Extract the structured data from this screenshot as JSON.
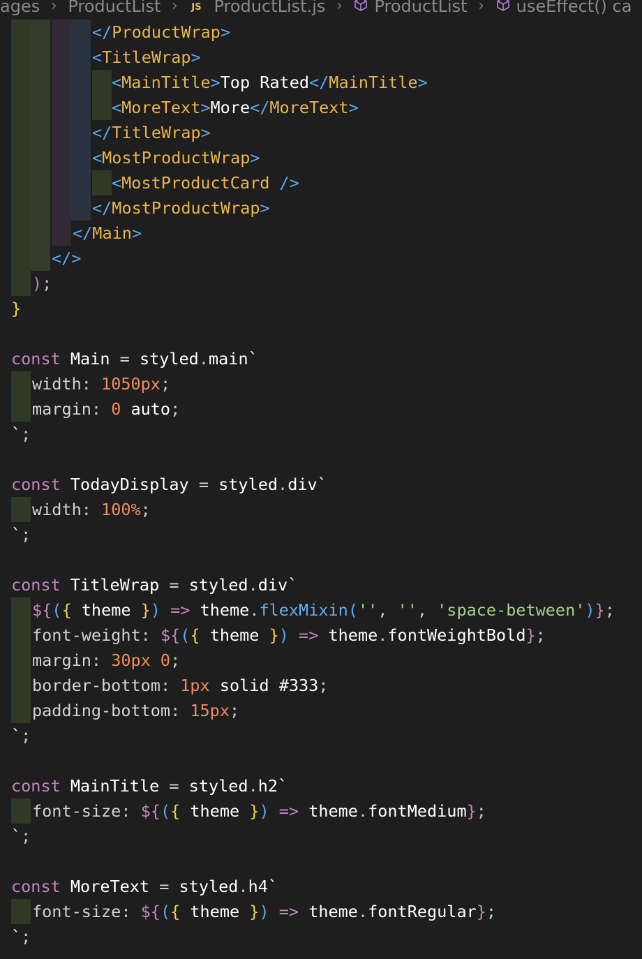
{
  "breadcrumb": {
    "items": [
      "ages",
      "ProductList",
      "ProductList.js",
      "ProductList",
      "useEffect() ca"
    ],
    "js_badge": "JS"
  },
  "colors": {
    "background": "#1e1e1e",
    "jsx_component": "#e9b44c",
    "jsx_bracket": "#5aa9f0",
    "keyword": "#c586c0",
    "number": "#f28b60",
    "string": "#a6d189",
    "method": "#61afef"
  },
  "code": {
    "lines": [
      {
        "tokens": [
          [
            "t-brace-b",
            "</"
          ],
          [
            "t-comp",
            "ProductWrap"
          ],
          [
            "t-brace-b",
            ">"
          ]
        ]
      },
      {
        "tokens": [
          [
            "t-brace-b",
            "<"
          ],
          [
            "t-comp",
            "TitleWrap"
          ],
          [
            "t-brace-b",
            ">"
          ]
        ]
      },
      {
        "tokens": [
          [
            "t-brace-b",
            "<"
          ],
          [
            "t-comp",
            "MainTitle"
          ],
          [
            "t-brace-b",
            ">"
          ],
          [
            "t-text",
            "Top Rated"
          ],
          [
            "t-brace-b",
            "</"
          ],
          [
            "t-comp",
            "MainTitle"
          ],
          [
            "t-brace-b",
            ">"
          ]
        ]
      },
      {
        "tokens": [
          [
            "t-brace-b",
            "<"
          ],
          [
            "t-comp",
            "MoreText"
          ],
          [
            "t-brace-b",
            ">"
          ],
          [
            "t-text",
            "More"
          ],
          [
            "t-brace-b",
            "</"
          ],
          [
            "t-comp",
            "MoreText"
          ],
          [
            "t-brace-b",
            ">"
          ]
        ]
      },
      {
        "tokens": [
          [
            "t-brace-b",
            "</"
          ],
          [
            "t-comp",
            "TitleWrap"
          ],
          [
            "t-brace-b",
            ">"
          ]
        ]
      },
      {
        "tokens": [
          [
            "t-brace-b",
            "<"
          ],
          [
            "t-comp",
            "MostProductWrap"
          ],
          [
            "t-brace-b",
            ">"
          ]
        ]
      },
      {
        "tokens": [
          [
            "t-brace-b",
            "<"
          ],
          [
            "t-comp",
            "MostProductCard"
          ],
          [
            "t-text",
            " "
          ],
          [
            "t-brace-b",
            "/>"
          ]
        ]
      },
      {
        "tokens": [
          [
            "t-brace-b",
            "</"
          ],
          [
            "t-comp",
            "MostProductWrap"
          ],
          [
            "t-brace-b",
            ">"
          ]
        ]
      },
      {
        "tokens": [
          [
            "t-brace-b",
            "</"
          ],
          [
            "t-comp",
            "Main"
          ],
          [
            "t-brace-b",
            ">"
          ]
        ]
      },
      {
        "tokens": [
          [
            "t-brace-b",
            "</>"
          ]
        ]
      },
      {
        "tokens": [
          [
            "t-brace-p",
            ")"
          ],
          [
            "t-punct",
            ";"
          ]
        ]
      },
      {
        "tokens": [
          [
            "t-brace-y",
            "}"
          ]
        ]
      },
      {
        "tokens": []
      },
      {
        "tokens": [
          [
            "t-kw",
            "const"
          ],
          [
            "t-id",
            " Main "
          ],
          [
            "t-op",
            "="
          ],
          [
            "t-id",
            " styled"
          ],
          [
            "t-punct",
            "."
          ],
          [
            "t-fn",
            "main"
          ],
          [
            "t-tpl",
            "`"
          ]
        ]
      },
      {
        "tokens": [
          [
            "t-prop",
            "width"
          ],
          [
            "t-punct",
            ": "
          ],
          [
            "t-num",
            "1050px"
          ],
          [
            "t-punct",
            ";"
          ]
        ]
      },
      {
        "tokens": [
          [
            "t-prop",
            "margin"
          ],
          [
            "t-punct",
            ": "
          ],
          [
            "t-num",
            "0"
          ],
          [
            "t-id",
            " auto"
          ],
          [
            "t-punct",
            ";"
          ]
        ]
      },
      {
        "tokens": [
          [
            "t-tpl",
            "`"
          ],
          [
            "t-punct",
            ";"
          ]
        ]
      },
      {
        "tokens": []
      },
      {
        "tokens": [
          [
            "t-kw",
            "const"
          ],
          [
            "t-id",
            " TodayDisplay "
          ],
          [
            "t-op",
            "="
          ],
          [
            "t-id",
            " styled"
          ],
          [
            "t-punct",
            "."
          ],
          [
            "t-fn",
            "div"
          ],
          [
            "t-tpl",
            "`"
          ]
        ]
      },
      {
        "tokens": [
          [
            "t-prop",
            "width"
          ],
          [
            "t-punct",
            ": "
          ],
          [
            "t-num",
            "100%"
          ],
          [
            "t-punct",
            ";"
          ]
        ]
      },
      {
        "tokens": [
          [
            "t-tpl",
            "`"
          ],
          [
            "t-punct",
            ";"
          ]
        ]
      },
      {
        "tokens": []
      },
      {
        "tokens": [
          [
            "t-kw",
            "const"
          ],
          [
            "t-id",
            " TitleWrap "
          ],
          [
            "t-op",
            "="
          ],
          [
            "t-id",
            " styled"
          ],
          [
            "t-punct",
            "."
          ],
          [
            "t-fn",
            "div"
          ],
          [
            "t-tpl",
            "`"
          ]
        ]
      },
      {
        "tokens": [
          [
            "t-dollar",
            "${"
          ],
          [
            "t-brace-b",
            "("
          ],
          [
            "t-brace-y",
            "{"
          ],
          [
            "t-id",
            " theme "
          ],
          [
            "t-brace-y",
            "}"
          ],
          [
            "t-brace-b",
            ")"
          ],
          [
            "t-kw",
            " =>"
          ],
          [
            "t-id",
            " theme"
          ],
          [
            "t-punct",
            "."
          ],
          [
            "t-method",
            "flexMixin"
          ],
          [
            "t-brace-b",
            "("
          ],
          [
            "t-str",
            "''"
          ],
          [
            "t-punct",
            ", "
          ],
          [
            "t-str",
            "''"
          ],
          [
            "t-punct",
            ", "
          ],
          [
            "t-str",
            "'space-between'"
          ],
          [
            "t-brace-b",
            ")"
          ],
          [
            "t-dollar",
            "}"
          ],
          [
            "t-punct",
            ";"
          ]
        ]
      },
      {
        "tokens": [
          [
            "t-prop",
            "font-weight"
          ],
          [
            "t-punct",
            ": "
          ],
          [
            "t-dollar",
            "${"
          ],
          [
            "t-brace-b",
            "("
          ],
          [
            "t-brace-y",
            "{"
          ],
          [
            "t-id",
            " theme "
          ],
          [
            "t-brace-y",
            "}"
          ],
          [
            "t-brace-b",
            ")"
          ],
          [
            "t-kw",
            " =>"
          ],
          [
            "t-id",
            " theme"
          ],
          [
            "t-punct",
            "."
          ],
          [
            "t-id",
            "fontWeightBold"
          ],
          [
            "t-dollar",
            "}"
          ],
          [
            "t-punct",
            ";"
          ]
        ]
      },
      {
        "tokens": [
          [
            "t-prop",
            "margin"
          ],
          [
            "t-punct",
            ": "
          ],
          [
            "t-num",
            "30px"
          ],
          [
            "t-num",
            " 0"
          ],
          [
            "t-punct",
            ";"
          ]
        ]
      },
      {
        "tokens": [
          [
            "t-prop",
            "border-bottom"
          ],
          [
            "t-punct",
            ": "
          ],
          [
            "t-num",
            "1px"
          ],
          [
            "t-id",
            " solid #333"
          ],
          [
            "t-punct",
            ";"
          ]
        ]
      },
      {
        "tokens": [
          [
            "t-prop",
            "padding-bottom"
          ],
          [
            "t-punct",
            ": "
          ],
          [
            "t-num",
            "15px"
          ],
          [
            "t-punct",
            ";"
          ]
        ]
      },
      {
        "tokens": [
          [
            "t-tpl",
            "`"
          ],
          [
            "t-punct",
            ";"
          ]
        ]
      },
      {
        "tokens": []
      },
      {
        "tokens": [
          [
            "t-kw",
            "const"
          ],
          [
            "t-id",
            " MainTitle "
          ],
          [
            "t-op",
            "="
          ],
          [
            "t-id",
            " styled"
          ],
          [
            "t-punct",
            "."
          ],
          [
            "t-fn",
            "h2"
          ],
          [
            "t-tpl",
            "`"
          ]
        ]
      },
      {
        "tokens": [
          [
            "t-prop",
            "font-size"
          ],
          [
            "t-punct",
            ": "
          ],
          [
            "t-dollar",
            "${"
          ],
          [
            "t-brace-b",
            "("
          ],
          [
            "t-brace-y",
            "{"
          ],
          [
            "t-id",
            " theme "
          ],
          [
            "t-brace-y",
            "}"
          ],
          [
            "t-brace-b",
            ")"
          ],
          [
            "t-kw",
            " =>"
          ],
          [
            "t-id",
            " theme"
          ],
          [
            "t-punct",
            "."
          ],
          [
            "t-id",
            "fontMedium"
          ],
          [
            "t-dollar",
            "}"
          ],
          [
            "t-punct",
            ";"
          ]
        ]
      },
      {
        "tokens": [
          [
            "t-tpl",
            "`"
          ],
          [
            "t-punct",
            ";"
          ]
        ]
      },
      {
        "tokens": []
      },
      {
        "tokens": [
          [
            "t-kw",
            "const"
          ],
          [
            "t-id",
            " MoreText "
          ],
          [
            "t-op",
            "="
          ],
          [
            "t-id",
            " styled"
          ],
          [
            "t-punct",
            "."
          ],
          [
            "t-fn",
            "h4"
          ],
          [
            "t-tpl",
            "`"
          ]
        ]
      },
      {
        "tokens": [
          [
            "t-prop",
            "font-size"
          ],
          [
            "t-punct",
            ": "
          ],
          [
            "t-dollar",
            "${"
          ],
          [
            "t-brace-b",
            "("
          ],
          [
            "t-brace-y",
            "{"
          ],
          [
            "t-id",
            " theme "
          ],
          [
            "t-brace-y",
            "}"
          ],
          [
            "t-brace-b",
            ")"
          ],
          [
            "t-kw",
            " =>"
          ],
          [
            "t-id",
            " theme"
          ],
          [
            "t-punct",
            "."
          ],
          [
            "t-id",
            "fontRegular"
          ],
          [
            "t-dollar",
            "}"
          ],
          [
            "t-punct",
            ";"
          ]
        ]
      },
      {
        "tokens": [
          [
            "t-tpl",
            "`"
          ],
          [
            "t-punct",
            ";"
          ]
        ]
      }
    ]
  }
}
